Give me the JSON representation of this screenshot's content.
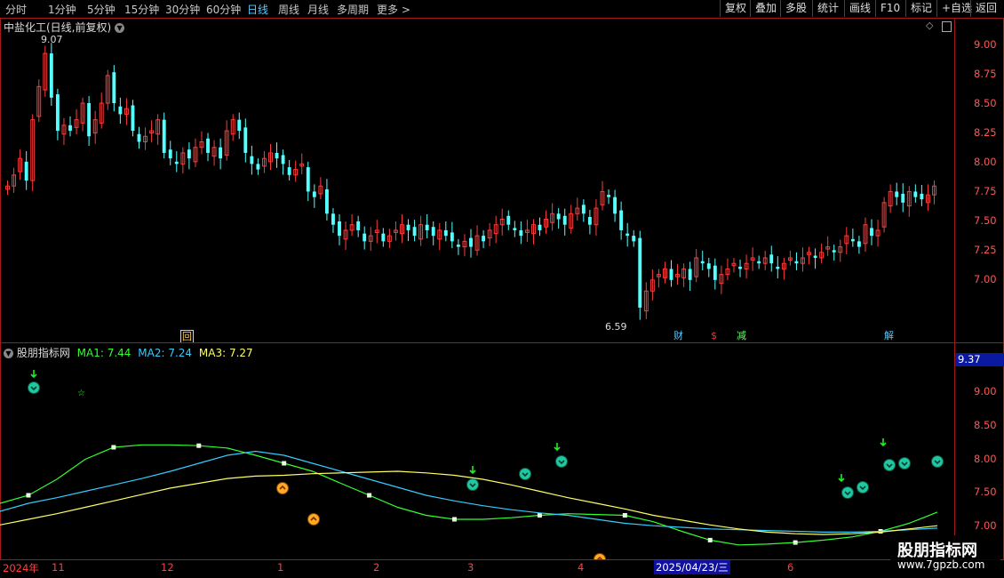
{
  "toolbar": {
    "periods": [
      "分时",
      "1分钟",
      "5分钟",
      "15分钟",
      "30分钟",
      "60分钟",
      "日线",
      "周线",
      "月线",
      "多周期",
      "更多 >"
    ],
    "active_period": "日线",
    "buttons": [
      "复权",
      "叠加",
      "多股",
      "统计",
      "画线",
      "F10",
      "标记",
      "+自选",
      "返回"
    ]
  },
  "main_chart": {
    "title": "中盐化工(日线,前复权)",
    "title_icon": "chevron-down-icon",
    "high_label": "9.07",
    "low_label": "6.59",
    "y_ticks": [
      "9.00",
      "8.75",
      "8.50",
      "8.25",
      "8.00",
      "7.75",
      "7.50",
      "7.25",
      "7.00"
    ],
    "event_flags": [
      {
        "text": "回",
        "color": "#ffcc66"
      },
      {
        "text": "财",
        "color": "#5bc8ff"
      },
      {
        "text": "$",
        "color": "#ff3030"
      },
      {
        "text": "减",
        "color": "#66ff66"
      },
      {
        "text": "解",
        "color": "#5bc8ff"
      }
    ]
  },
  "indicator": {
    "name": "股朋指标网",
    "ma1": "MA1: 7.44",
    "ma2": "MA2: 7.24",
    "ma3": "MA3: 7.27",
    "current_value": "9.37",
    "y_ticks": [
      "9.00",
      "8.50",
      "8.00",
      "7.50",
      "7.00"
    ]
  },
  "time_axis": {
    "labels": [
      "2024年",
      "11",
      "12",
      "1",
      "2",
      "3",
      "4",
      "2025/04/23/三",
      "6"
    ]
  },
  "watermark": {
    "title": "股朋指标网",
    "url": "www.7gpzb.com"
  },
  "colors": {
    "up": "#ff3b3b",
    "down": "#54ffff",
    "ma1": "#33ff33",
    "ma2": "#33ccff",
    "ma3": "#ffff66",
    "axis": "#ff4040",
    "frame": "#a01a1a"
  },
  "chart_data": [
    {
      "type": "candlestick",
      "title": "中盐化工(日线,前复权)",
      "ylim": [
        6.45,
        9.25
      ],
      "close": [
        7.8,
        7.9,
        8.05,
        7.85,
        8.4,
        8.7,
        9.0,
        8.6,
        8.3,
        8.35,
        8.3,
        8.4,
        8.55,
        8.25,
        8.4,
        8.55,
        8.8,
        8.55,
        8.45,
        8.5,
        8.3,
        8.2,
        8.25,
        8.3,
        8.4,
        8.1,
        8.05,
        8.0,
        8.1,
        8.05,
        8.15,
        8.2,
        8.1,
        8.15,
        8.05,
        8.3,
        8.4,
        8.3,
        8.1,
        8.0,
        7.95,
        8.05,
        8.1,
        8.05,
        8.0,
        7.9,
        7.95,
        8.0,
        7.75,
        7.7,
        7.8,
        7.55,
        7.45,
        7.35,
        7.4,
        7.45,
        7.4,
        7.3,
        7.35,
        7.4,
        7.3,
        7.35,
        7.4,
        7.45,
        7.4,
        7.35,
        7.45,
        7.4,
        7.35,
        7.4,
        7.35,
        7.3,
        7.25,
        7.3,
        7.25,
        7.35,
        7.3,
        7.4,
        7.45,
        7.5,
        7.45,
        7.4,
        7.35,
        7.4,
        7.45,
        7.4,
        7.5,
        7.55,
        7.5,
        7.45,
        7.55,
        7.6,
        7.55,
        7.45,
        7.6,
        7.75,
        7.7,
        7.55,
        7.4,
        7.35,
        7.3,
        6.7,
        6.85,
        6.95,
        7.0,
        7.05,
        6.95,
        7.0,
        7.05,
        6.95,
        7.15,
        7.1,
        7.05,
        6.95,
        7.0,
        7.05,
        7.1,
        7.05,
        7.1,
        7.15,
        7.1,
        7.15,
        7.1,
        7.05,
        7.1,
        7.15,
        7.1,
        7.15,
        7.2,
        7.15,
        7.2,
        7.25,
        7.2,
        7.25,
        7.35,
        7.3,
        7.25,
        7.45,
        7.35,
        7.4,
        7.65,
        7.75,
        7.7,
        7.65,
        7.75,
        7.7,
        7.68,
        7.72,
        7.8
      ],
      "high": 9.07,
      "low": 6.59
    },
    {
      "type": "line",
      "title": "股朋指标网",
      "ylim": [
        6.85,
        9.55
      ],
      "series": [
        {
          "name": "MA1",
          "values": [
            7.55,
            7.65,
            7.85,
            8.1,
            8.25,
            8.28,
            8.28,
            8.27,
            8.24,
            8.15,
            8.05,
            7.95,
            7.8,
            7.65,
            7.5,
            7.4,
            7.35,
            7.35,
            7.37,
            7.4,
            7.42,
            7.41,
            7.4,
            7.32,
            7.2,
            7.09,
            7.03,
            7.04,
            7.06,
            7.09,
            7.13,
            7.2,
            7.3,
            7.44
          ]
        },
        {
          "name": "MA2",
          "values": [
            7.45,
            7.55,
            7.62,
            7.7,
            7.78,
            7.86,
            7.95,
            8.05,
            8.15,
            8.2,
            8.15,
            8.05,
            7.95,
            7.85,
            7.75,
            7.65,
            7.58,
            7.52,
            7.47,
            7.43,
            7.4,
            7.35,
            7.3,
            7.27,
            7.25,
            7.23,
            7.22,
            7.21,
            7.2,
            7.19,
            7.19,
            7.2,
            7.22,
            7.24
          ]
        },
        {
          "name": "MA3",
          "values": [
            7.28,
            7.35,
            7.42,
            7.5,
            7.58,
            7.66,
            7.74,
            7.8,
            7.86,
            7.89,
            7.9,
            7.92,
            7.93,
            7.94,
            7.95,
            7.93,
            7.9,
            7.85,
            7.78,
            7.7,
            7.62,
            7.55,
            7.48,
            7.4,
            7.34,
            7.28,
            7.23,
            7.19,
            7.17,
            7.16,
            7.17,
            7.19,
            7.23,
            7.27
          ]
        }
      ]
    }
  ]
}
